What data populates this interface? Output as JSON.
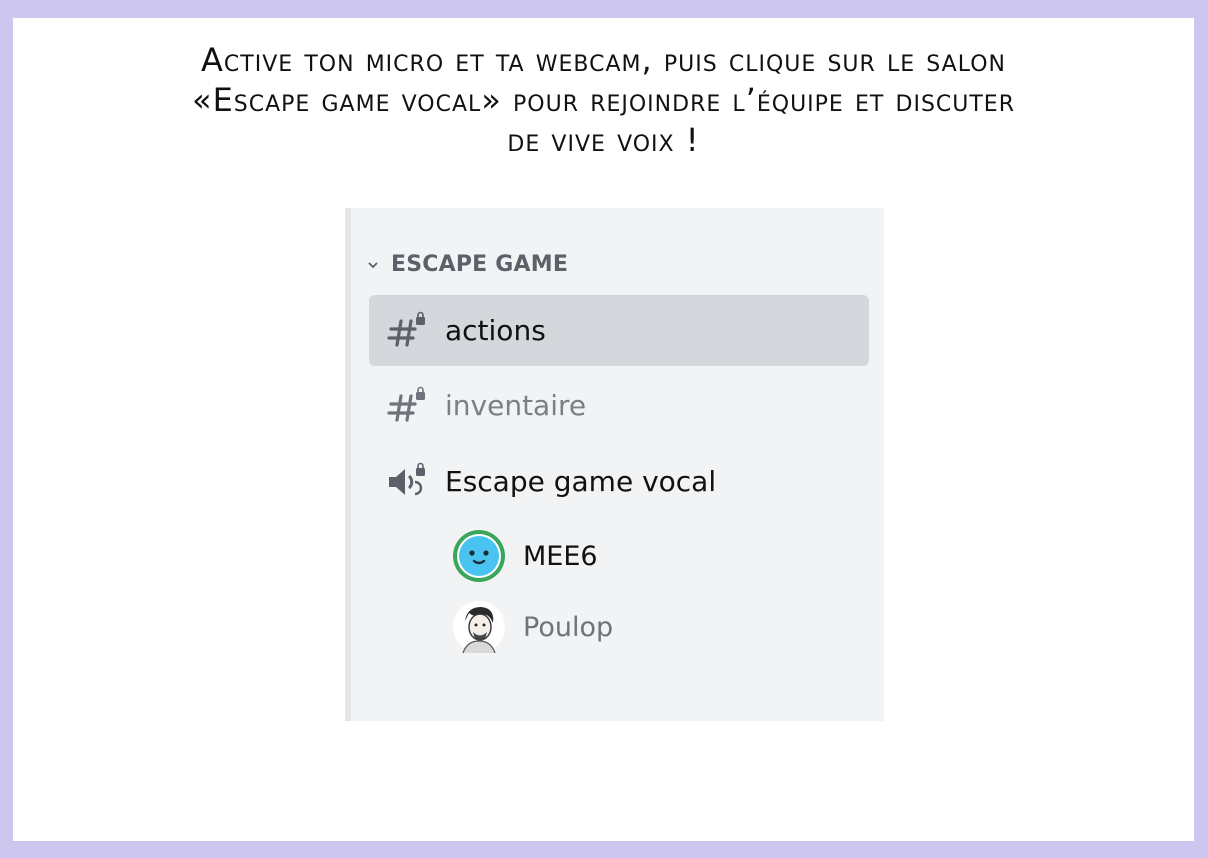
{
  "instruction": {
    "line1": "Active ton micro et ta webcam, puis clique sur le salon",
    "line2": "«Escape game vocal» pour rejoindre l’équipe et discuter",
    "line3": "de vive voix !"
  },
  "sidebar": {
    "category": {
      "label": "ESCAPE GAME",
      "icon": "chevron-down-icon"
    },
    "channels": [
      {
        "label": "actions",
        "type": "text",
        "icon": "hashtag-lock-icon",
        "selected": true
      },
      {
        "label": "inventaire",
        "type": "text",
        "icon": "hashtag-lock-icon",
        "selected": false
      },
      {
        "label": "Escape game vocal",
        "type": "voice",
        "icon": "speaker-lock-icon",
        "selected": false
      }
    ],
    "voice_members": [
      {
        "name": "MEE6",
        "avatar": "mee6-avatar"
      },
      {
        "name": "Poulop",
        "avatar": "poulop-avatar"
      }
    ]
  },
  "colors": {
    "frame": "#cdc6ee",
    "panel": "#f2f3f5",
    "selected": "#d4d7dc",
    "muted_text": "#7b7f87",
    "mee6_ring": "#3ba55c",
    "mee6_face": "#49c4f0"
  }
}
